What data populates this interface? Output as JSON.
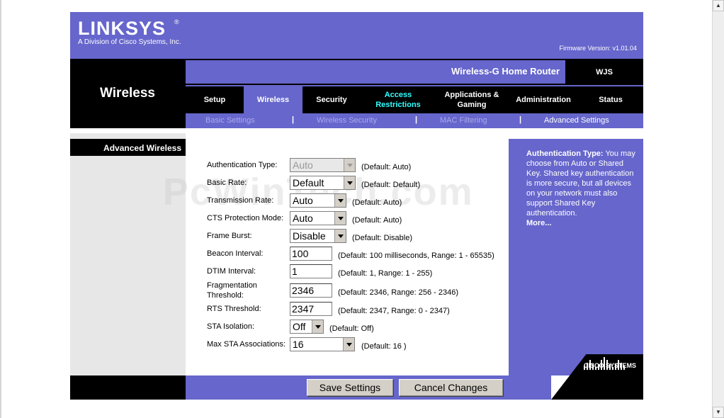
{
  "header": {
    "logo": "LINKSYS",
    "logo_reg": "®",
    "logo_sub": "A Division of Cisco Systems, Inc.",
    "firmware": "Firmware Version: v1.01.04"
  },
  "nav": {
    "section_title": "Wireless",
    "product_name": "Wireless-G Home Router",
    "model": "WJS",
    "tabs": [
      {
        "label": "Setup"
      },
      {
        "label": "Wireless"
      },
      {
        "label": "Security"
      },
      {
        "label": "Access Restrictions"
      },
      {
        "label": "Applications & Gaming"
      },
      {
        "label": "Administration"
      },
      {
        "label": "Status"
      }
    ],
    "subnav": [
      {
        "label": "Basic Settings"
      },
      {
        "label": "Wireless Security"
      },
      {
        "label": "MAC Filtering"
      },
      {
        "label": "Advanced Settings"
      }
    ],
    "separator": "|"
  },
  "sidebar": {
    "label": "Advanced Wireless"
  },
  "form": {
    "rows": [
      {
        "label": "Authentication Type:",
        "value": "Auto",
        "default": "(Default: Auto)"
      },
      {
        "label": "Basic Rate:",
        "value": "Default",
        "default": "(Default: Default)"
      },
      {
        "label": "Transmission Rate:",
        "value": "Auto",
        "default": "(Default: Auto)"
      },
      {
        "label": "CTS Protection Mode:",
        "value": "Auto",
        "default": "(Default: Auto)"
      },
      {
        "label": "Frame Burst:",
        "value": "Disable",
        "default": "(Default: Disable)"
      },
      {
        "label": "Beacon Interval:",
        "value": "100",
        "default": "(Default: 100 milliseconds, Range: 1 - 65535)"
      },
      {
        "label": "DTIM Interval:",
        "value": "1",
        "default": "(Default: 1, Range: 1 - 255)"
      },
      {
        "label": "Fragmentation Threshold:",
        "label_line1": "Fragmentation",
        "label_line2": "Threshold:",
        "value": "2346",
        "default": "(Default: 2346, Range: 256 - 2346)"
      },
      {
        "label": "RTS Threshold:",
        "value": "2347",
        "default": "(Default: 2347, Range: 0 - 2347)"
      },
      {
        "label": "STA Isolation:",
        "value": "Off",
        "default": "(Default: Off)"
      },
      {
        "label": "Max STA Associations:",
        "value": "16",
        "default": "(Default: 16 )"
      }
    ]
  },
  "help": {
    "title": "Authentication Type:",
    "body": "You may choose from Auto or Shared Key. Shared key authentication is more secure, but all devices on your network must also support Shared Key authentication.",
    "more": "More..."
  },
  "footer": {
    "save_label": "Save Settings",
    "cancel_label": "Cancel Changes",
    "cisco_label": "CISCO SYSTEMS"
  },
  "watermark": "PcWinTech.com",
  "colors": {
    "brand_purple": "#6666cc",
    "black": "#000000",
    "tab_cyan": "#33ffff"
  }
}
